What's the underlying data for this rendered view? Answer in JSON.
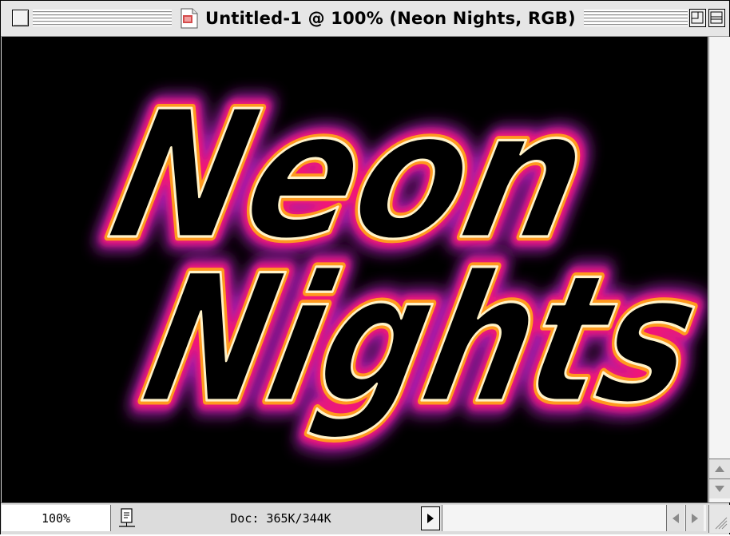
{
  "window": {
    "title": "Untitled-1 @ 100% (Neon  Nights, RGB)"
  },
  "canvas": {
    "text_line1": "Neon",
    "text_line2": "Nights",
    "colors": {
      "background": "#000000",
      "glow_outer": "#a01ea8",
      "glow_mid": "#f01878",
      "glow_inner": "#ff9a1e",
      "highlight": "#fff2c8",
      "letter_fill": "#000000"
    }
  },
  "status": {
    "zoom": "100%",
    "doc_info": "Doc: 365K/344K"
  },
  "icons": {
    "close_box": "close-box-icon",
    "document": "document-icon",
    "zoom_box": "zoom-box-icon",
    "collapse_box": "collapse-box-icon",
    "print_preview": "print-preview-icon",
    "popup_arrow": "triangle-right-icon",
    "scroll_up": "arrow-up-icon",
    "scroll_down": "arrow-down-icon",
    "scroll_left": "arrow-left-icon",
    "scroll_right": "arrow-right-icon",
    "grow_box": "resize-grip-icon"
  }
}
